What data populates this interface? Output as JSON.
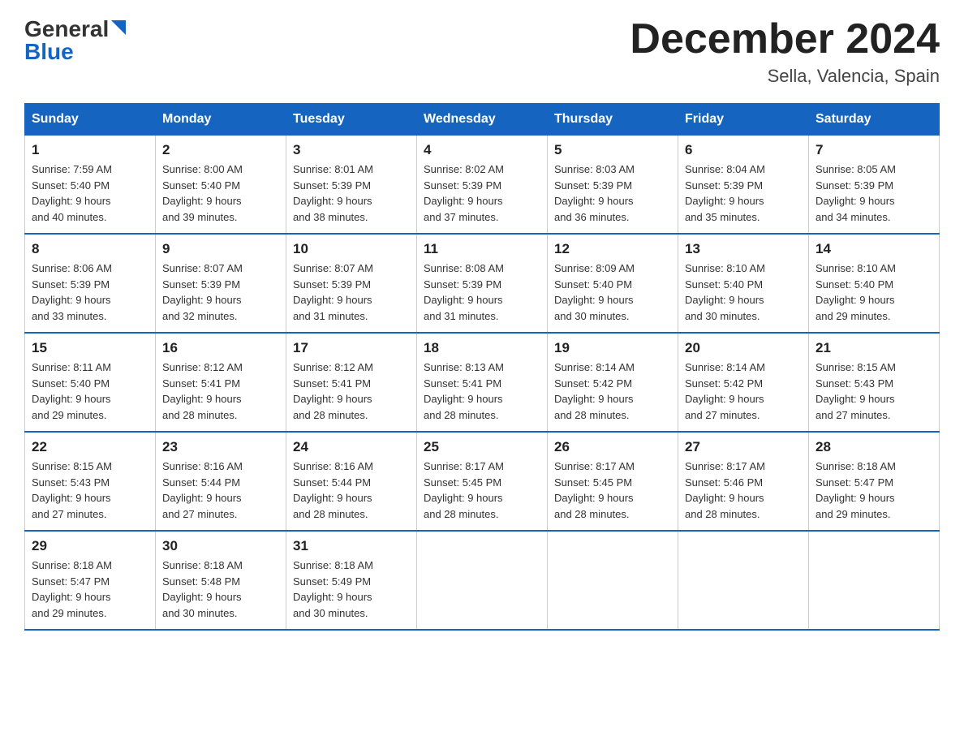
{
  "header": {
    "logo_general": "General",
    "logo_blue": "Blue",
    "title": "December 2024",
    "subtitle": "Sella, Valencia, Spain"
  },
  "days_of_week": [
    "Sunday",
    "Monday",
    "Tuesday",
    "Wednesday",
    "Thursday",
    "Friday",
    "Saturday"
  ],
  "weeks": [
    [
      {
        "day": "1",
        "sunrise": "7:59 AM",
        "sunset": "5:40 PM",
        "daylight": "9 hours and 40 minutes."
      },
      {
        "day": "2",
        "sunrise": "8:00 AM",
        "sunset": "5:40 PM",
        "daylight": "9 hours and 39 minutes."
      },
      {
        "day": "3",
        "sunrise": "8:01 AM",
        "sunset": "5:39 PM",
        "daylight": "9 hours and 38 minutes."
      },
      {
        "day": "4",
        "sunrise": "8:02 AM",
        "sunset": "5:39 PM",
        "daylight": "9 hours and 37 minutes."
      },
      {
        "day": "5",
        "sunrise": "8:03 AM",
        "sunset": "5:39 PM",
        "daylight": "9 hours and 36 minutes."
      },
      {
        "day": "6",
        "sunrise": "8:04 AM",
        "sunset": "5:39 PM",
        "daylight": "9 hours and 35 minutes."
      },
      {
        "day": "7",
        "sunrise": "8:05 AM",
        "sunset": "5:39 PM",
        "daylight": "9 hours and 34 minutes."
      }
    ],
    [
      {
        "day": "8",
        "sunrise": "8:06 AM",
        "sunset": "5:39 PM",
        "daylight": "9 hours and 33 minutes."
      },
      {
        "day": "9",
        "sunrise": "8:07 AM",
        "sunset": "5:39 PM",
        "daylight": "9 hours and 32 minutes."
      },
      {
        "day": "10",
        "sunrise": "8:07 AM",
        "sunset": "5:39 PM",
        "daylight": "9 hours and 31 minutes."
      },
      {
        "day": "11",
        "sunrise": "8:08 AM",
        "sunset": "5:39 PM",
        "daylight": "9 hours and 31 minutes."
      },
      {
        "day": "12",
        "sunrise": "8:09 AM",
        "sunset": "5:40 PM",
        "daylight": "9 hours and 30 minutes."
      },
      {
        "day": "13",
        "sunrise": "8:10 AM",
        "sunset": "5:40 PM",
        "daylight": "9 hours and 30 minutes."
      },
      {
        "day": "14",
        "sunrise": "8:10 AM",
        "sunset": "5:40 PM",
        "daylight": "9 hours and 29 minutes."
      }
    ],
    [
      {
        "day": "15",
        "sunrise": "8:11 AM",
        "sunset": "5:40 PM",
        "daylight": "9 hours and 29 minutes."
      },
      {
        "day": "16",
        "sunrise": "8:12 AM",
        "sunset": "5:41 PM",
        "daylight": "9 hours and 28 minutes."
      },
      {
        "day": "17",
        "sunrise": "8:12 AM",
        "sunset": "5:41 PM",
        "daylight": "9 hours and 28 minutes."
      },
      {
        "day": "18",
        "sunrise": "8:13 AM",
        "sunset": "5:41 PM",
        "daylight": "9 hours and 28 minutes."
      },
      {
        "day": "19",
        "sunrise": "8:14 AM",
        "sunset": "5:42 PM",
        "daylight": "9 hours and 28 minutes."
      },
      {
        "day": "20",
        "sunrise": "8:14 AM",
        "sunset": "5:42 PM",
        "daylight": "9 hours and 27 minutes."
      },
      {
        "day": "21",
        "sunrise": "8:15 AM",
        "sunset": "5:43 PM",
        "daylight": "9 hours and 27 minutes."
      }
    ],
    [
      {
        "day": "22",
        "sunrise": "8:15 AM",
        "sunset": "5:43 PM",
        "daylight": "9 hours and 27 minutes."
      },
      {
        "day": "23",
        "sunrise": "8:16 AM",
        "sunset": "5:44 PM",
        "daylight": "9 hours and 27 minutes."
      },
      {
        "day": "24",
        "sunrise": "8:16 AM",
        "sunset": "5:44 PM",
        "daylight": "9 hours and 28 minutes."
      },
      {
        "day": "25",
        "sunrise": "8:17 AM",
        "sunset": "5:45 PM",
        "daylight": "9 hours and 28 minutes."
      },
      {
        "day": "26",
        "sunrise": "8:17 AM",
        "sunset": "5:45 PM",
        "daylight": "9 hours and 28 minutes."
      },
      {
        "day": "27",
        "sunrise": "8:17 AM",
        "sunset": "5:46 PM",
        "daylight": "9 hours and 28 minutes."
      },
      {
        "day": "28",
        "sunrise": "8:18 AM",
        "sunset": "5:47 PM",
        "daylight": "9 hours and 29 minutes."
      }
    ],
    [
      {
        "day": "29",
        "sunrise": "8:18 AM",
        "sunset": "5:47 PM",
        "daylight": "9 hours and 29 minutes."
      },
      {
        "day": "30",
        "sunrise": "8:18 AM",
        "sunset": "5:48 PM",
        "daylight": "9 hours and 30 minutes."
      },
      {
        "day": "31",
        "sunrise": "8:18 AM",
        "sunset": "5:49 PM",
        "daylight": "9 hours and 30 minutes."
      },
      null,
      null,
      null,
      null
    ]
  ],
  "labels": {
    "sunrise": "Sunrise:",
    "sunset": "Sunset:",
    "daylight": "Daylight:"
  }
}
